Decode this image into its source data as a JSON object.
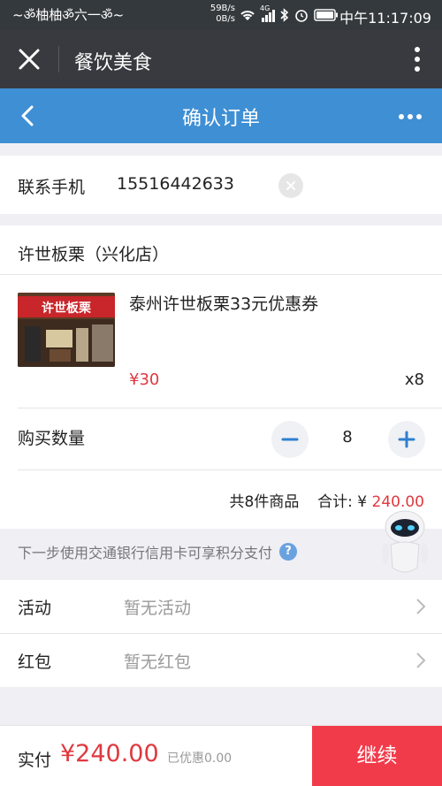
{
  "status_bar": {
    "left_text": "~ॐ柚柚ॐ六一ॐ~",
    "net_speed_up": "59B/s",
    "net_speed_down": "0B/s",
    "network": "4G",
    "time": "中午11:17:09"
  },
  "top_bar": {
    "title": "餐饮美食"
  },
  "page_header": {
    "title": "确认订单"
  },
  "contact": {
    "label": "联系手机",
    "phone": "15516442633"
  },
  "store": {
    "name": "许世板栗（兴化店）",
    "sign_text": "许世板栗"
  },
  "product": {
    "title": "泰州许世板栗33元优惠券",
    "price": "¥30",
    "quantity": "x8"
  },
  "purchase": {
    "label": "购买数量",
    "quantity": "8"
  },
  "summary": {
    "count_text": "共8件商品",
    "total_label": "合计: ¥ ",
    "total_amount": "240.00"
  },
  "notice": {
    "text": "下一步使用交通银行信用卡可享积分支付",
    "help": "?"
  },
  "options": [
    {
      "label": "活动",
      "value": "暂无活动"
    },
    {
      "label": "红包",
      "value": "暂无红包"
    }
  ],
  "bottom": {
    "pay_label": "实付",
    "pay_amount": "¥240.00",
    "discount": "已优惠0.00",
    "continue_label": "继续"
  },
  "colors": {
    "header_blue": "#3f8fd4",
    "price_red": "#e0383f",
    "continue_red": "#f23b4a"
  }
}
